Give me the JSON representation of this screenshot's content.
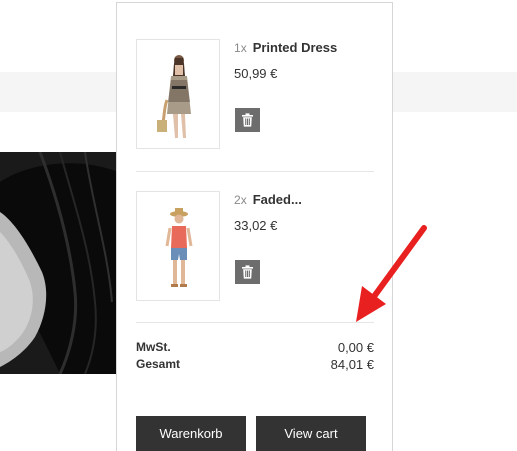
{
  "cart": {
    "items": [
      {
        "quantity": "1",
        "times": "x",
        "name": "Printed Dress",
        "price": "50,99 €",
        "delete_icon": "trash-icon"
      },
      {
        "quantity": "2",
        "times": "x",
        "name": "Faded...",
        "price": "33,02 €",
        "delete_icon": "trash-icon"
      }
    ],
    "totals": {
      "tax_label": "MwSt.",
      "tax_value": "0,00 €",
      "total_label": "Gesamt",
      "total_value": "84,01 €"
    },
    "buttons": {
      "cart_label": "Warenkorb",
      "view_cart_label": "View cart"
    }
  },
  "annotation": {
    "arrow_color": "#e82020"
  }
}
